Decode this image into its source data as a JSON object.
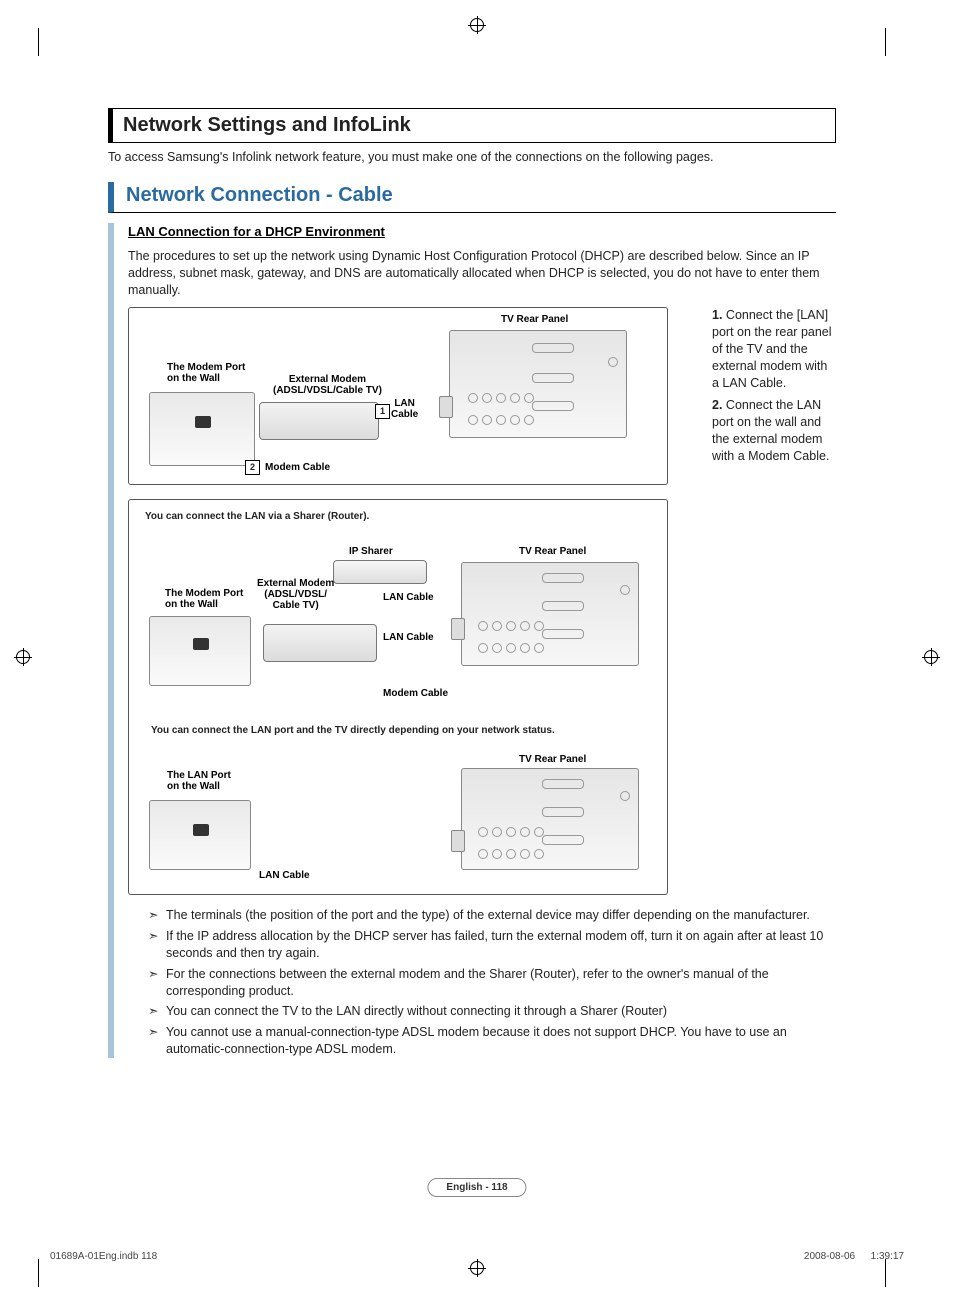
{
  "headings": {
    "main": "Network Settings and InfoLink",
    "sub": "Network Connection - Cable",
    "subsub": "LAN Connection for a DHCP Environment"
  },
  "intro": "To access Samsung's Infolink network feature, you must make one of the connections on the following pages.",
  "para": "The procedures to set up the network using Dynamic Host Configuration Protocol (DHCP) are described below. Since an IP address, subnet mask, gateway, and DNS are automatically allocated when DHCP is selected, you do not have to enter them manually.",
  "steps": [
    "Connect the [LAN] port on the rear panel of the TV and the external modem with a LAN Cable.",
    "Connect the LAN port on the wall and the external modem with a Modem Cable."
  ],
  "diagram1": {
    "tv_rear_panel": "TV Rear Panel",
    "modem_port_wall": "The Modem Port\non the Wall",
    "external_modem": "External Modem\n(ADSL/VDSL/Cable TV)",
    "lan_cable": "LAN\nCable",
    "modem_cable": "Modem Cable",
    "step1": "1",
    "step2": "2"
  },
  "diagram2": {
    "title1": "You can connect the LAN via a Sharer (Router).",
    "ip_sharer": "IP Sharer",
    "tv_rear_panel": "TV Rear Panel",
    "modem_port_wall": "The Modem Port\non the Wall",
    "external_modem": "External Modem\n(ADSL/VDSL/\nCable TV)",
    "lan_cable": "LAN Cable",
    "lan_cable2": "LAN Cable",
    "modem_cable": "Modem Cable",
    "title2": "You can connect the LAN port and the TV directly depending on your network status.",
    "lan_port_wall": "The LAN Port\non the Wall",
    "tv_rear_panel2": "TV Rear Panel",
    "lan_cable3": "LAN Cable"
  },
  "notes": [
    "The terminals (the position of the port and the type) of the external device may differ depending on the manufacturer.",
    "If the IP address allocation by the DHCP server has failed, turn the external modem off, turn it on again after at least 10 seconds and then try again.",
    "For the connections between the external modem and the Sharer (Router), refer to the owner's manual of the corresponding product.",
    "You can connect the TV to the LAN directly without connecting it through a Sharer (Router)",
    "You cannot use a manual-connection-type ADSL modem because it does not support DHCP. You have to use an automatic-connection-type ADSL modem."
  ],
  "page_label": "English - 118",
  "footer": {
    "left": "01689A-01Eng.indb   118",
    "right": "2008-08-06      1:39:17"
  }
}
